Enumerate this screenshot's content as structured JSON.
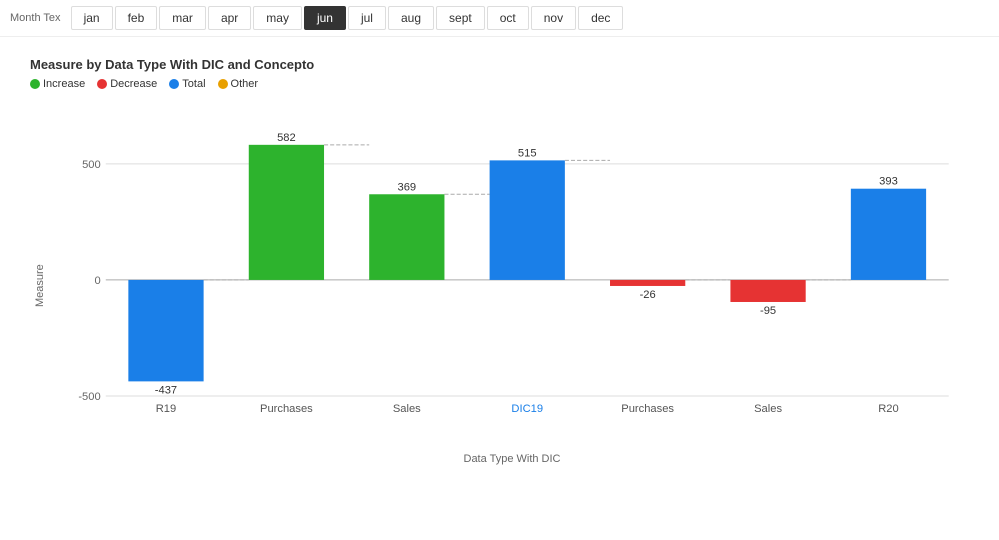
{
  "header": {
    "month_label": "Month Tex",
    "months": [
      "jan",
      "feb",
      "mar",
      "apr",
      "may",
      "jun",
      "jul",
      "aug",
      "sept",
      "oct",
      "nov",
      "dec"
    ],
    "active_month": "jun"
  },
  "chart": {
    "title": "Measure by Data Type With DIC and Concepto",
    "legend": [
      {
        "label": "Increase",
        "color": "#2db32d"
      },
      {
        "label": "Decrease",
        "color": "#e63333"
      },
      {
        "label": "Total",
        "color": "#1a7fe8"
      },
      {
        "label": "Other",
        "color": "#e8a000"
      }
    ],
    "y_axis_label": "Measure",
    "x_axis_label": "Data Type With DIC",
    "bars": [
      {
        "label": "R19",
        "value": -437,
        "color": "#1a7fe8",
        "type": "total"
      },
      {
        "label": "Purchases",
        "value": 582,
        "color": "#2db32d",
        "type": "increase"
      },
      {
        "label": "Sales",
        "value": 369,
        "color": "#2db32d",
        "type": "increase"
      },
      {
        "label": "DIC19",
        "value": 515,
        "color": "#1a7fe8",
        "type": "total"
      },
      {
        "label": "Purchases",
        "value": -26,
        "color": "#e63333",
        "type": "decrease"
      },
      {
        "label": "Sales",
        "value": -95,
        "color": "#e63333",
        "type": "decrease"
      },
      {
        "label": "R20",
        "value": 393,
        "color": "#1a7fe8",
        "type": "total"
      }
    ],
    "y_ticks": [
      500,
      0,
      -500
    ],
    "y_ref_line": 500
  }
}
